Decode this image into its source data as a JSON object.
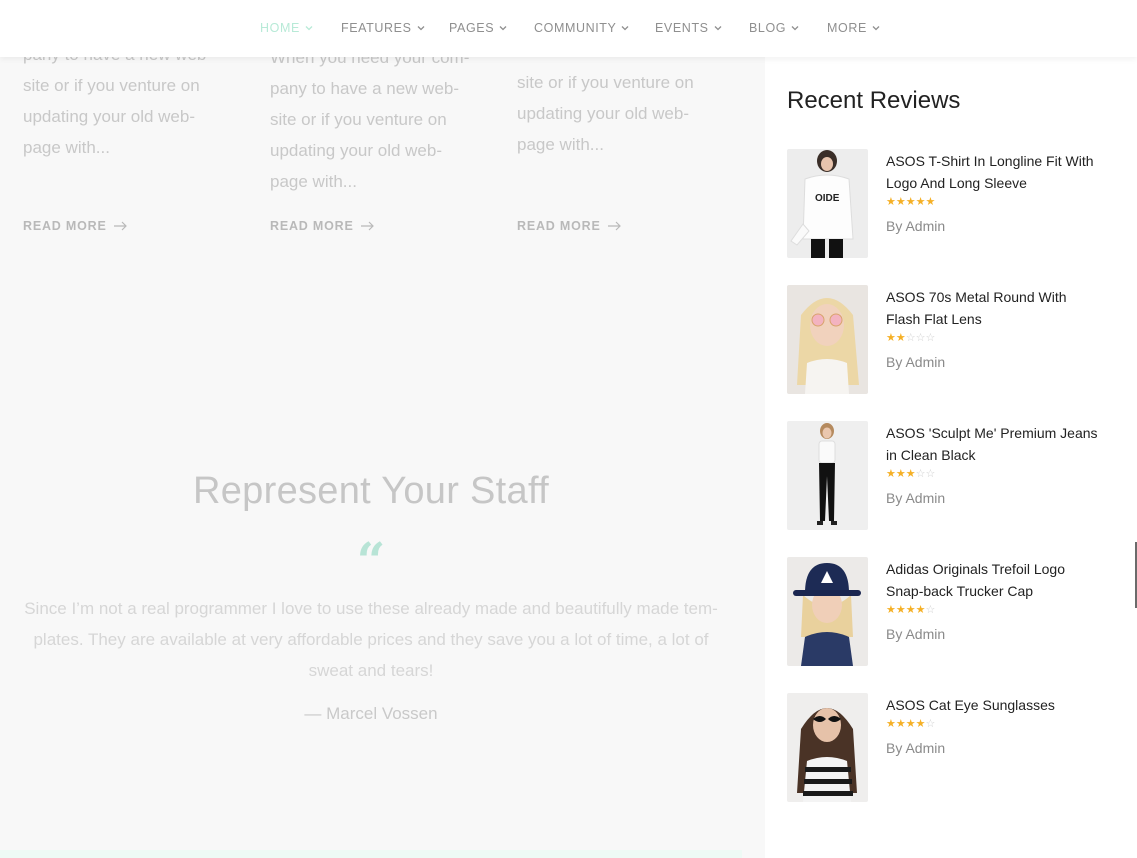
{
  "nav": {
    "items": [
      {
        "label": "HOME",
        "active": true
      },
      {
        "label": "FEATURES",
        "active": false
      },
      {
        "label": "PAGES",
        "active": false
      },
      {
        "label": "COMMUNITY",
        "active": false
      },
      {
        "label": "EVENTS",
        "active": false
      },
      {
        "label": "BLOG",
        "active": false
      },
      {
        "label": "MORE",
        "active": false
      }
    ],
    "active_color": "#b8ead7"
  },
  "posts": [
    {
      "excerpt": "pany to have a new web-\nsite or if you venture on\nupdating your old web-\npage with...",
      "read_more": "READ MORE"
    },
    {
      "excerpt": "When you need your com-\npany to have a new web-\nsite or if you venture on\nupdating your old web-\npage with...",
      "read_more": "READ MORE"
    },
    {
      "excerpt": "site or if you venture on\nupdating your old web-\npage with...",
      "read_more": "READ MORE"
    }
  ],
  "staff": {
    "title": "Represent Your Staff",
    "quote_mark": "“",
    "text": "Since I’m not a real programmer I love to use these already made and beautifully made tem-plates. They are available at very affordable prices and they save you a lot of time, a lot of sweat and tears!",
    "author": "— Marcel Vossen"
  },
  "sidebar": {
    "title": "Recent Reviews",
    "reviews": [
      {
        "title": "ASOS T-Shirt In Longline Fit With Logo And Long Sleeve",
        "rating": 5,
        "by": "By Admin",
        "image": "white-shirt-model"
      },
      {
        "title": "ASOS 70s Metal Round With Flash Flat Lens",
        "rating": 2,
        "by": "By Admin",
        "image": "blonde-sunglasses-model"
      },
      {
        "title": "ASOS 'Sculpt Me' Premium Jeans in Clean Black",
        "rating": 3,
        "by": "By Admin",
        "image": "jeans-model"
      },
      {
        "title": "Adidas Originals Trefoil Logo Snap-back Trucker Cap",
        "rating": 4,
        "by": "By Admin",
        "image": "cap-model"
      },
      {
        "title": "ASOS Cat Eye Sunglasses",
        "rating": 4,
        "by": "By Admin",
        "image": "cat-eye-model"
      }
    ]
  },
  "colors": {
    "star_on": "#f5b026",
    "star_off": "#cfcfcf",
    "accent": "#b8e4d6"
  }
}
